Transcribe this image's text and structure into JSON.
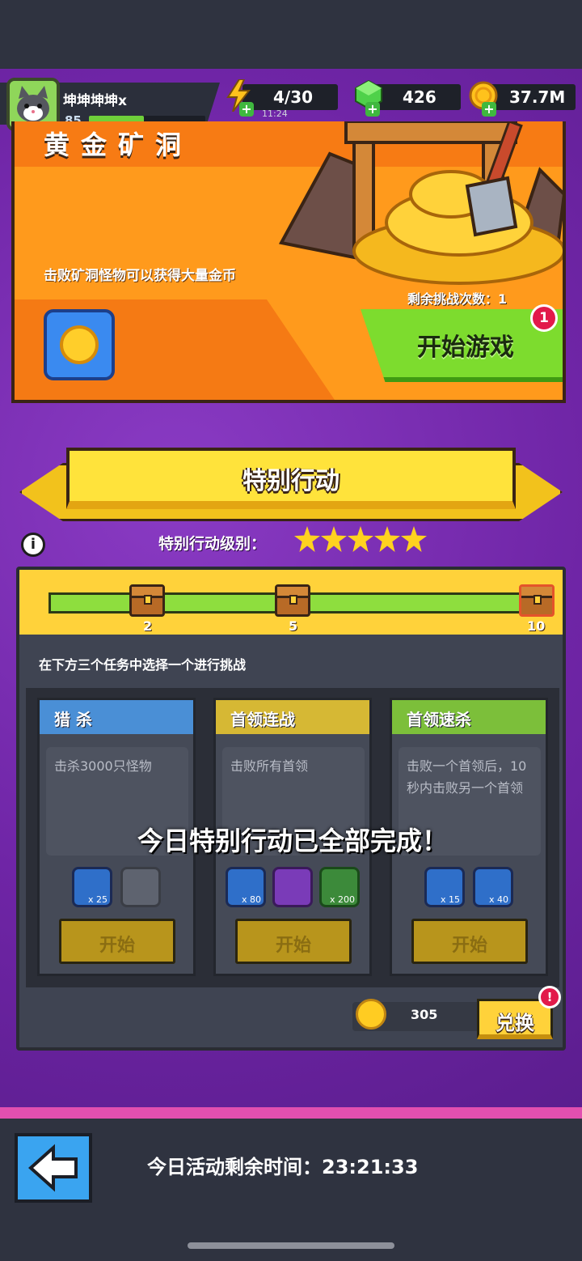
{
  "player": {
    "name": "坤坤坤坤x",
    "level": "85",
    "xp_fraction": 0.47
  },
  "resources": {
    "energy": {
      "value": "4/30",
      "timer": "11:24"
    },
    "gems": {
      "value": "426"
    },
    "coins": {
      "value": "37.7M"
    }
  },
  "mine": {
    "title": "黄金矿洞",
    "description": "击败矿洞怪物可以获得大量金币",
    "remaining_attempts": "剩余挑战次数：1",
    "start_button": "开始游戏",
    "notification_count": "1"
  },
  "special_action": {
    "banner_title": "特别行动",
    "level_label": "特别行动级别：",
    "stars": 5,
    "progress": {
      "fraction": 1.0,
      "milestones": [
        "2",
        "5",
        "10"
      ]
    },
    "instruction": "在下方三个任务中选择一个进行挑战",
    "completed_message": "今日特别行动已全部完成！",
    "tasks": [
      {
        "title": "猎 杀",
        "description": "击杀3000只怪物",
        "color": "#4a8fd6",
        "rewards": [
          {
            "icon": "coin-chest-icon",
            "qty": "x 25"
          },
          {
            "icon": "locked-item-icon",
            "qty": ""
          }
        ],
        "button": "开始"
      },
      {
        "title": "首领连战",
        "description": "击败所有首领",
        "color": "#d6b834",
        "rewards": [
          {
            "icon": "coin-icon",
            "qty": "x 80"
          },
          {
            "icon": "purple-shield-icon",
            "qty": ""
          },
          {
            "icon": "green-gem-icon",
            "qty": "x 200"
          }
        ],
        "button": "开始"
      },
      {
        "title": "首领速杀",
        "description": "击败一个首领后，10秒内击败另一个首领",
        "color": "#7cbf3a",
        "rewards": [
          {
            "icon": "coin-icon",
            "qty": "x 15"
          },
          {
            "icon": "fire-drop-icon",
            "qty": "x 40"
          }
        ],
        "button": "开始"
      }
    ],
    "exchange": {
      "value": "305",
      "button": "兑换"
    }
  },
  "footer": {
    "remaining_time": "今日活动剩余时间：23:21:33"
  }
}
